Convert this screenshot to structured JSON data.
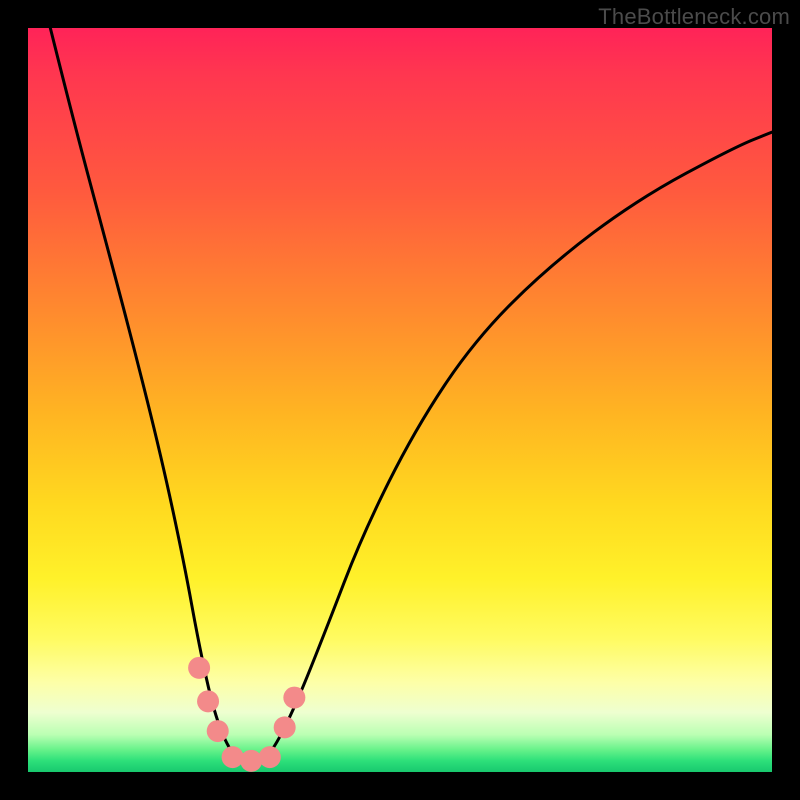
{
  "watermark": "TheBottleneck.com",
  "chart_data": {
    "type": "line",
    "title": "",
    "xlabel": "",
    "ylabel": "",
    "xlim": [
      0,
      100
    ],
    "ylim": [
      0,
      100
    ],
    "series": [
      {
        "name": "bottleneck-curve",
        "x": [
          3,
          6,
          10,
          14,
          18,
          21,
          23,
          25,
          27,
          29,
          31,
          33,
          36,
          40,
          45,
          52,
          60,
          70,
          82,
          95,
          100
        ],
        "y": [
          100,
          88,
          73,
          58,
          42,
          28,
          17,
          8,
          3,
          1,
          1,
          3,
          9,
          19,
          32,
          46,
          58,
          68,
          77,
          84,
          86
        ]
      }
    ],
    "markers": [
      {
        "name": "left-dot-1",
        "x": 23.0,
        "y": 14.0
      },
      {
        "name": "left-dot-2",
        "x": 24.2,
        "y": 9.5
      },
      {
        "name": "left-dot-3",
        "x": 25.5,
        "y": 5.5
      },
      {
        "name": "floor-dot-1",
        "x": 27.5,
        "y": 2.0
      },
      {
        "name": "floor-dot-2",
        "x": 30.0,
        "y": 1.5
      },
      {
        "name": "floor-dot-3",
        "x": 32.5,
        "y": 2.0
      },
      {
        "name": "right-dot-1",
        "x": 34.5,
        "y": 6.0
      },
      {
        "name": "right-dot-2",
        "x": 35.8,
        "y": 10.0
      }
    ],
    "marker_color": "#f38a8a",
    "curve_color": "#000000"
  }
}
